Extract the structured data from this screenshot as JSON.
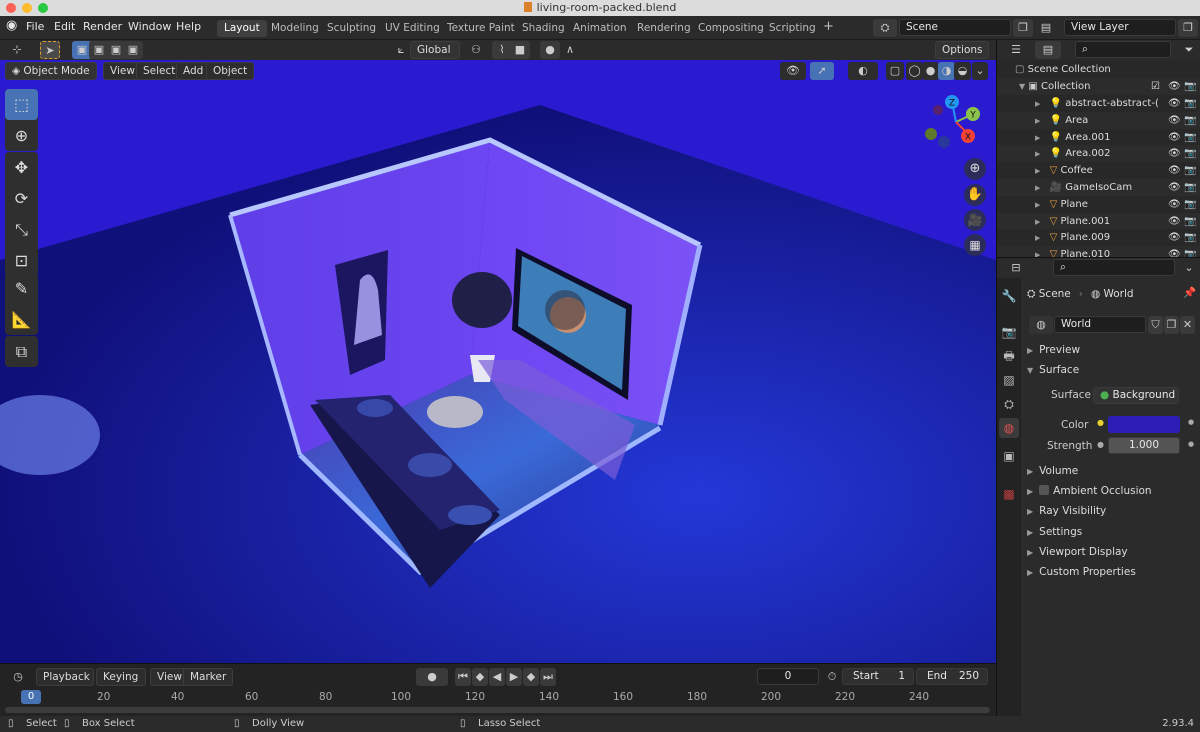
{
  "window": {
    "title": "living-room-packed.blend"
  },
  "menu": [
    "File",
    "Edit",
    "Render",
    "Window",
    "Help"
  ],
  "workspaces": [
    "Layout",
    "Modeling",
    "Sculpting",
    "UV Editing",
    "Texture Paint",
    "Shading",
    "Animation",
    "Rendering",
    "Compositing",
    "Scripting"
  ],
  "active_workspace": "Layout",
  "scene_field": "Scene",
  "view_layer_field": "View Layer",
  "viewport_toolbar": {
    "transform_orientation": "Global",
    "options": "Options"
  },
  "viewport_header": {
    "mode": "Object Mode",
    "menus": [
      "View",
      "Select",
      "Add",
      "Object"
    ]
  },
  "gizmo": {
    "x": "X",
    "y": "Y",
    "z": "Z"
  },
  "colors": {
    "accent": "#4772b3",
    "world_color": "#2d1fb5",
    "viewport_bg": "#2a1bd0"
  },
  "timeline": {
    "menus": [
      "Playback",
      "Keying",
      "View",
      "Marker"
    ],
    "current_frame": "0",
    "start_label": "Start",
    "start": "1",
    "end_label": "End",
    "end": "250",
    "ruler": [
      "0",
      "20",
      "40",
      "60",
      "80",
      "100",
      "120",
      "140",
      "160",
      "180",
      "200",
      "220",
      "240"
    ]
  },
  "status": {
    "select": "Select",
    "box_select": "Box Select",
    "dolly": "Dolly View",
    "lasso": "Lasso Select",
    "version": "2.93.4"
  },
  "outliner": {
    "scene_collection": "Scene Collection",
    "collection": "Collection",
    "items": [
      {
        "name": "abstract-abstract-(",
        "icon": "light-icon"
      },
      {
        "name": "Area",
        "icon": "light-icon"
      },
      {
        "name": "Area.001",
        "icon": "light-icon"
      },
      {
        "name": "Area.002",
        "icon": "light-icon"
      },
      {
        "name": "Coffee",
        "icon": "mesh-icon"
      },
      {
        "name": "GameIsoCam",
        "icon": "camera-icon"
      },
      {
        "name": "Plane",
        "icon": "mesh-icon"
      },
      {
        "name": "Plane.001",
        "icon": "mesh-icon"
      },
      {
        "name": "Plane.009",
        "icon": "mesh-icon"
      },
      {
        "name": "Plane.010",
        "icon": "mesh-icon"
      }
    ]
  },
  "properties": {
    "breadcrumb_scene": "Scene",
    "breadcrumb_world": "World",
    "world_name": "World",
    "sections": {
      "preview": "Preview",
      "surface": "Surface",
      "volume": "Volume",
      "ambient_occlusion": "Ambient Occlusion",
      "ray_visibility": "Ray Visibility",
      "settings": "Settings",
      "viewport_display": "Viewport Display",
      "custom_properties": "Custom Properties"
    },
    "surface_label": "Surface",
    "surface_value": "Background",
    "color_label": "Color",
    "strength_label": "Strength",
    "strength_value": "1.000"
  }
}
